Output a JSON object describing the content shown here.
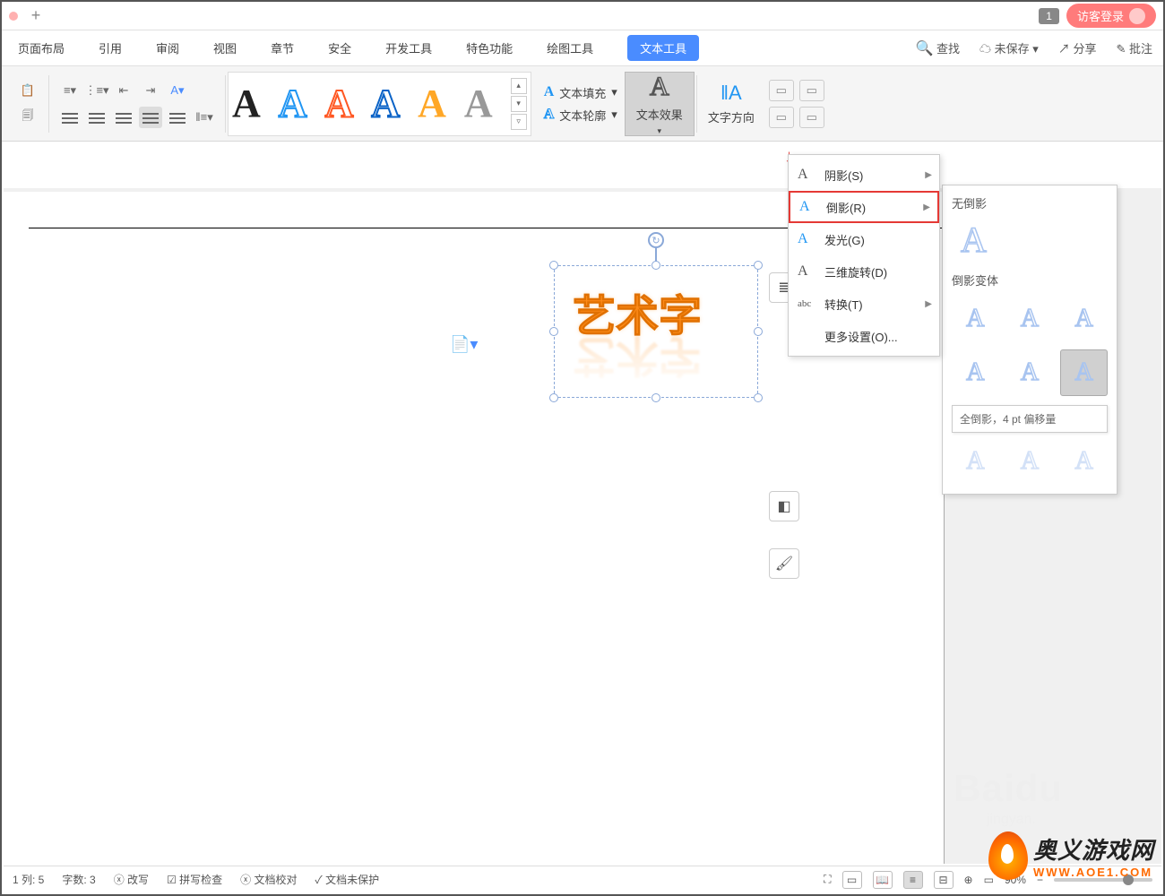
{
  "titlebar": {
    "badge": "1",
    "login": "访客登录"
  },
  "menu": {
    "items": [
      "页面布局",
      "引用",
      "审阅",
      "视图",
      "章节",
      "安全",
      "开发工具",
      "特色功能",
      "绘图工具"
    ],
    "text_tools": "文本工具",
    "search": "查找",
    "unsaved": "未保存",
    "share": "分享",
    "annotate": "批注"
  },
  "ribbon": {
    "text_fill": "文本填充",
    "text_outline": "文本轮廓",
    "text_effect": "文本效果",
    "text_direction": "文字方向"
  },
  "wordart": {
    "text": "艺术字"
  },
  "effect_menu": {
    "shadow": "阴影(S)",
    "reflection": "倒影(R)",
    "glow": "发光(G)",
    "rotate3d": "三维旋转(D)",
    "transform": "转换(T)",
    "more": "更多设置(O)..."
  },
  "reflection_panel": {
    "none": "无倒影",
    "variants": "倒影变体",
    "tooltip": "全倒影，4 pt 偏移量"
  },
  "status": {
    "col": "1 列: 5",
    "words": "字数: 3",
    "rewrite": "改写",
    "spellcheck": "拼写检查",
    "proof": "文档校对",
    "protect": "文档未保护",
    "zoom": "90%"
  },
  "logo": {
    "cn": "奥义游戏网",
    "en": "WWW.AOE1.COM"
  },
  "watermark": {
    "main": "Baidu",
    "sub": "jingyan."
  }
}
